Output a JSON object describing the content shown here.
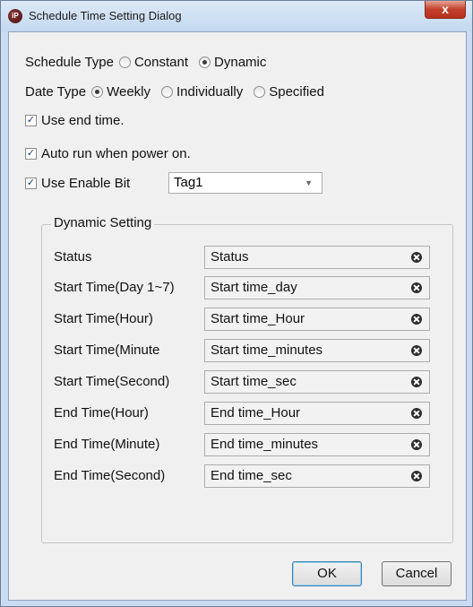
{
  "window": {
    "title": "Schedule Time Setting Dialog",
    "close_glyph": "x",
    "app_icon_text": "iP"
  },
  "schedule_type": {
    "label": "Schedule Type",
    "options": [
      "Constant",
      "Dynamic"
    ],
    "selected": "Dynamic"
  },
  "date_type": {
    "label": "Date Type",
    "options": [
      "Weekly",
      "Individually",
      "Specified"
    ],
    "selected": "Weekly"
  },
  "checks": {
    "use_end_time": {
      "label": "Use end time.",
      "checked": true
    },
    "auto_run": {
      "label": "Auto run when power on.",
      "checked": true
    },
    "enable_bit": {
      "label": "Use Enable Bit",
      "checked": true,
      "value": "Tag1"
    }
  },
  "dynamic": {
    "title": "Dynamic Setting",
    "rows": [
      {
        "label": "Status",
        "value": "Status"
      },
      {
        "label": "Start Time(Day 1~7)",
        "value": "Start time_day"
      },
      {
        "label": "Start Time(Hour)",
        "value": "Start time_Hour"
      },
      {
        "label": "Start Time(Minute",
        "value": "Start time_minutes"
      },
      {
        "label": "Start Time(Second)",
        "value": "Start time_sec"
      },
      {
        "label": "End Time(Hour)",
        "value": "End time_Hour"
      },
      {
        "label": "End Time(Minute)",
        "value": "End time_minutes"
      },
      {
        "label": "End Time(Second)",
        "value": "End time_sec"
      }
    ]
  },
  "buttons": {
    "ok": "OK",
    "cancel": "Cancel"
  },
  "check_glyph": "✓"
}
